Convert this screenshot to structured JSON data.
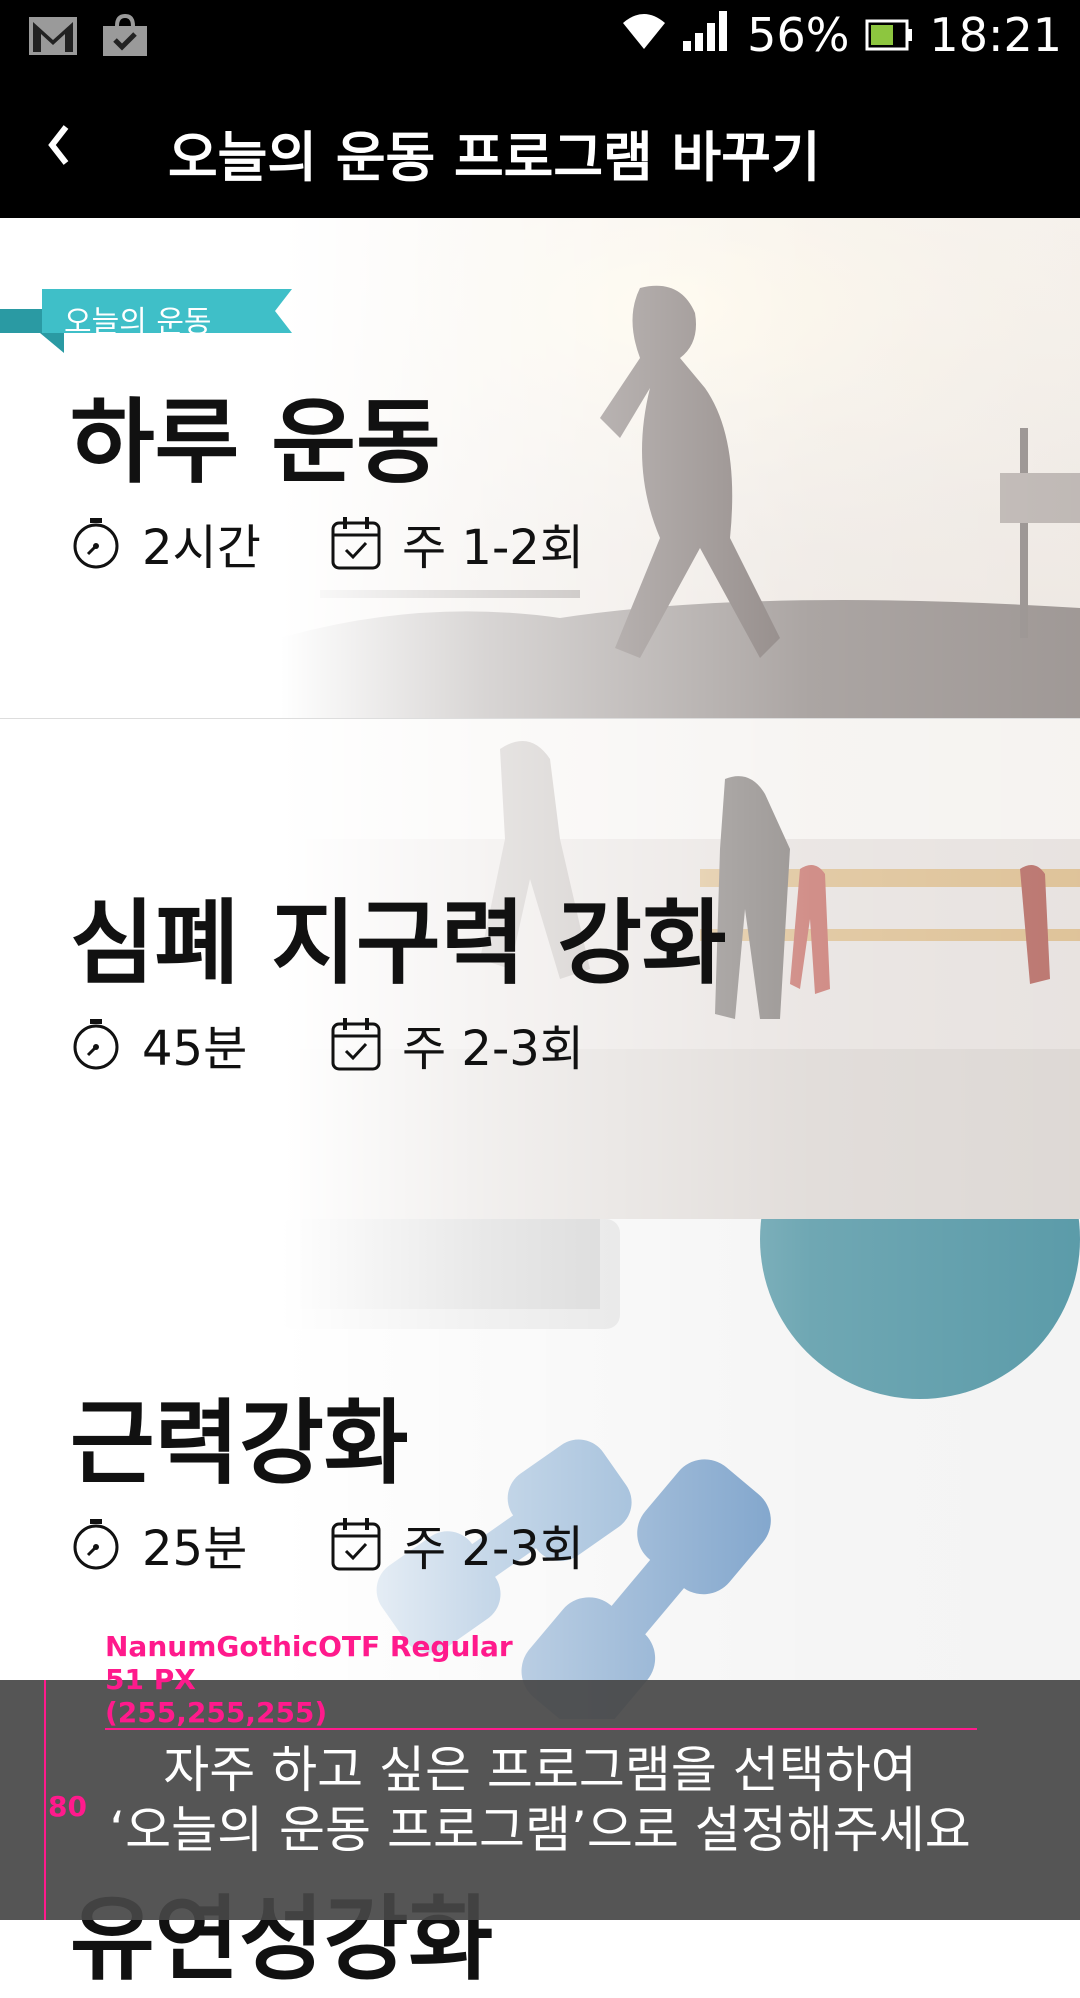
{
  "status_bar": {
    "left_icons": [
      "gmail-icon",
      "shopping-bag-icon"
    ],
    "battery_percent": "56%",
    "time": "18:21"
  },
  "app_bar": {
    "back_icon": "chevron-left-icon",
    "title": "오늘의 운동 프로그램 바꾸기"
  },
  "programs": [
    {
      "title": "하루 운동",
      "duration": "2시간",
      "frequency": "주 1-2회",
      "badge": "오늘의 운동",
      "image": "runner-photo"
    },
    {
      "title": "심폐 지구력 강화",
      "duration": "45분",
      "frequency": "주 2-3회",
      "image": "gym-photo"
    },
    {
      "title": "근력강화",
      "duration": "25분",
      "frequency": "주 2-3회",
      "image": "dumbbell-photo"
    },
    {
      "title": "유연성강화"
    }
  ],
  "overlay": {
    "line1": "자주 하고 싶은 프로그램을 선택하여",
    "line2": "‘오늘의 운동 프로그램’으로 설정해주세요"
  },
  "spec_annotation": {
    "font_name": "NanumGothicOTF Regular",
    "font_size": "51 PX",
    "color_value": "(255,255,255)",
    "height_value": "80"
  },
  "colors": {
    "accent_teal": "#3fbfc8",
    "bar_background": "#000000",
    "spec_magenta": "#ff1a8c"
  }
}
